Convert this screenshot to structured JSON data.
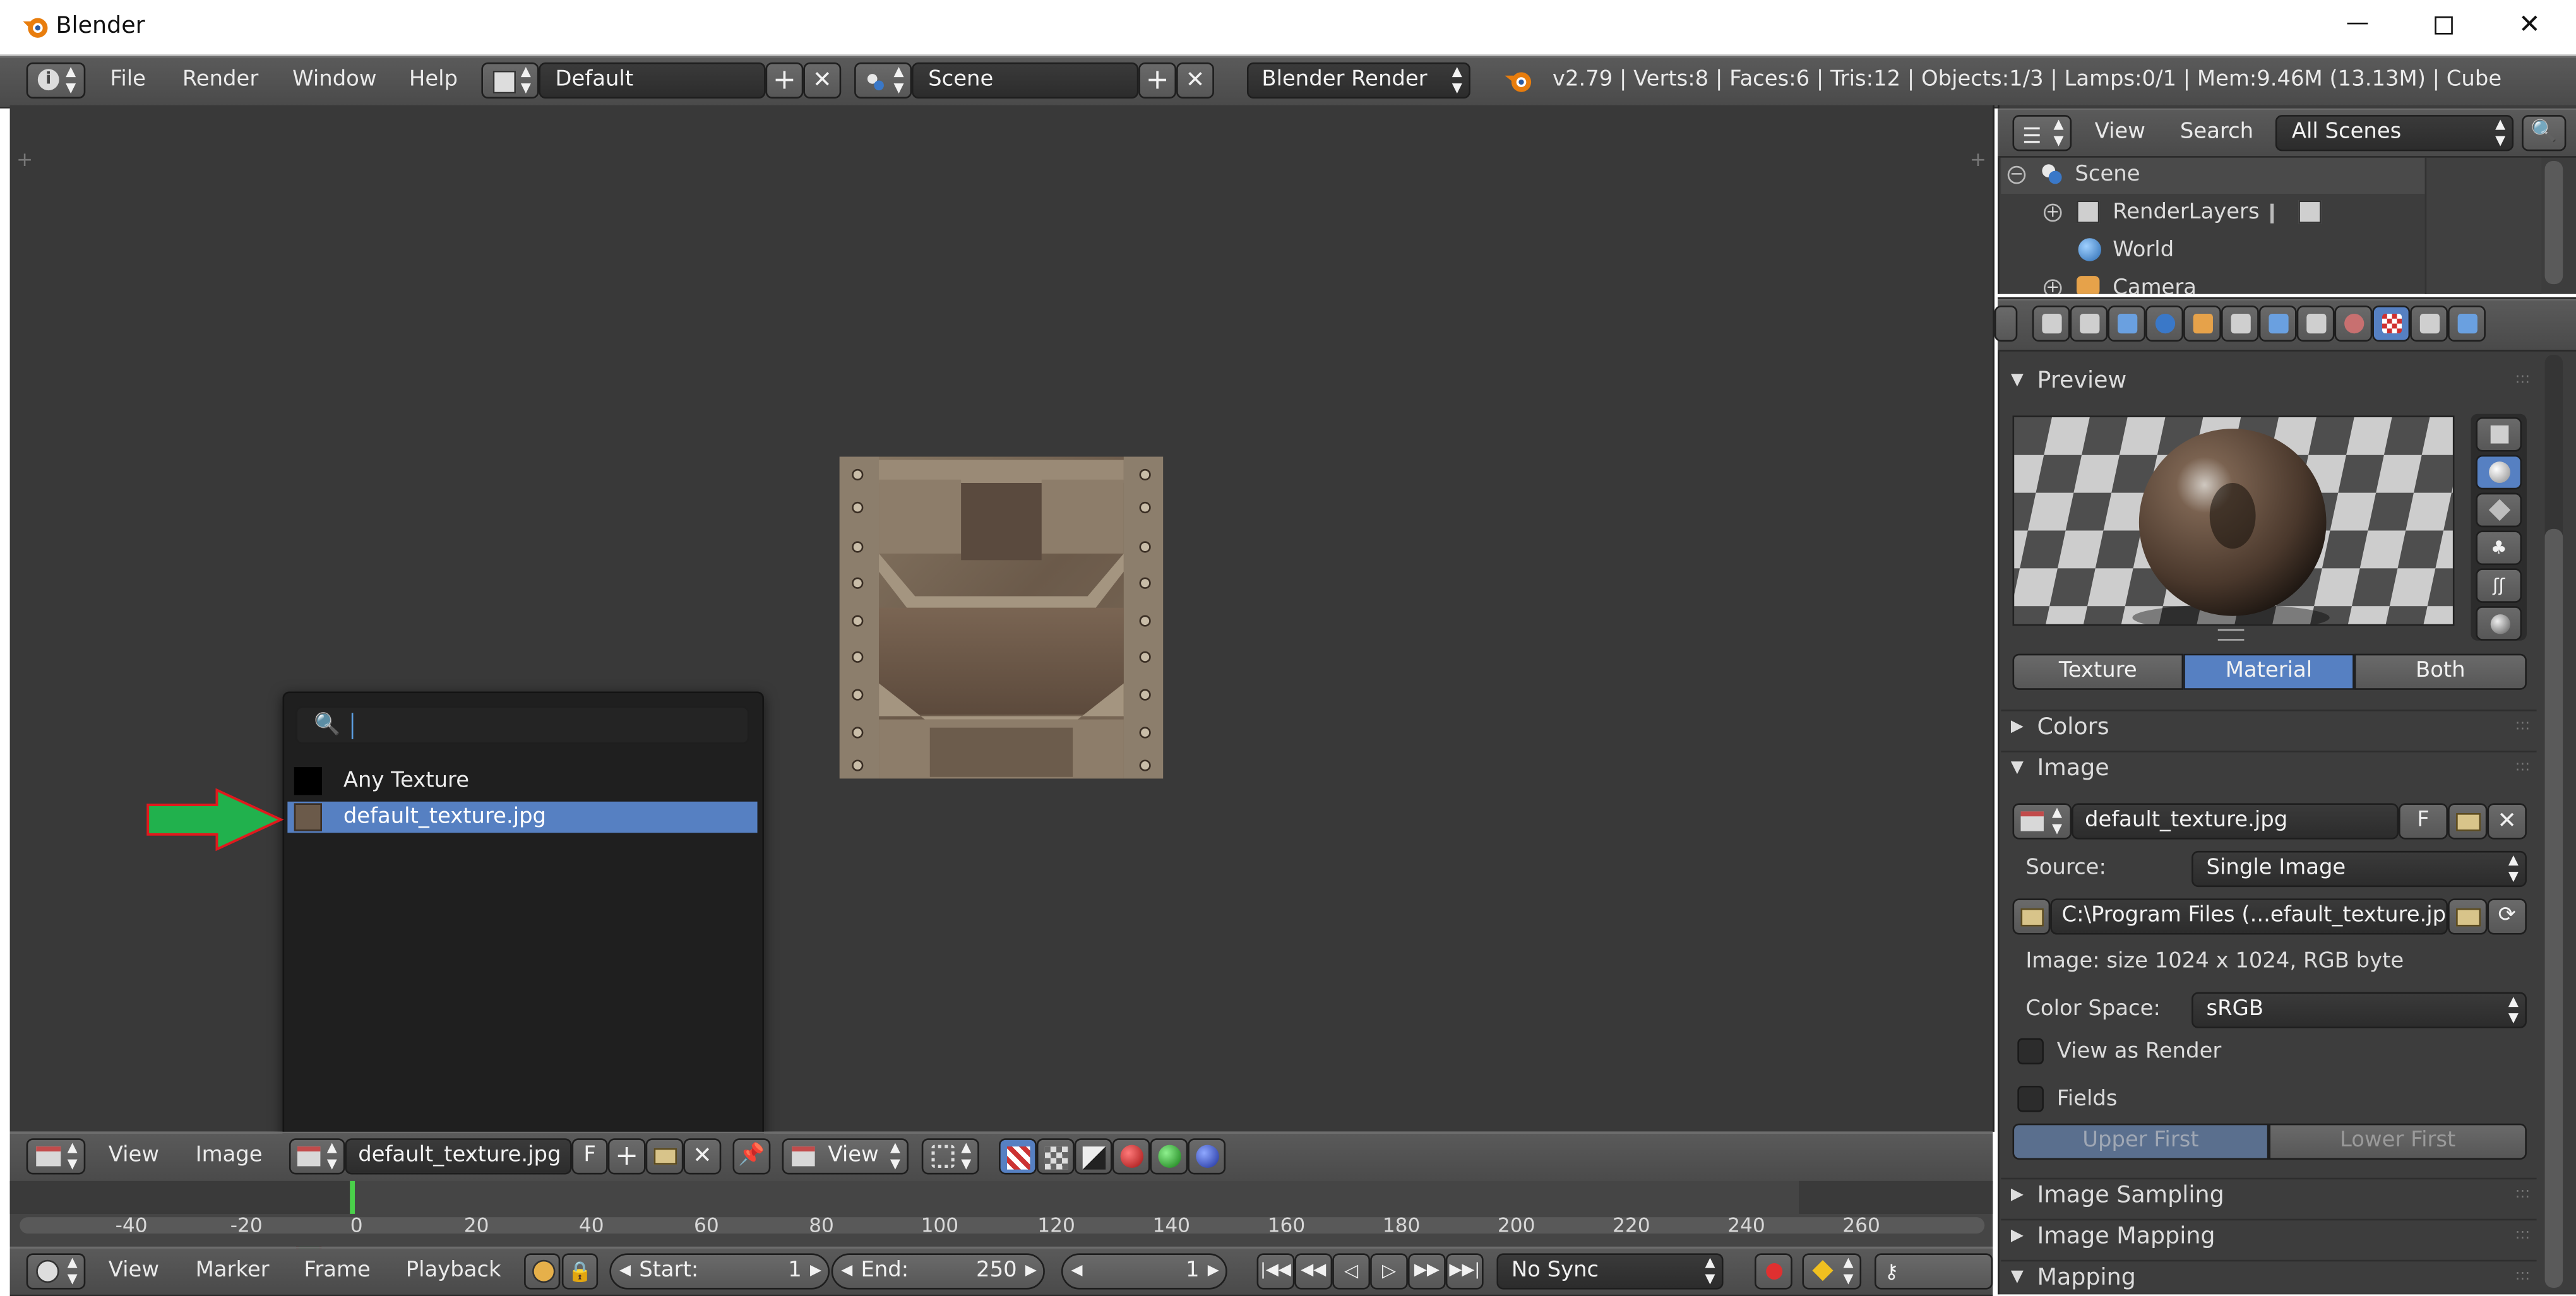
{
  "window": {
    "title": "Blender",
    "minimize_icon": "minimize-icon",
    "maximize_icon": "maximize-icon",
    "close_icon": "close-icon"
  },
  "info_header": {
    "menus": [
      "File",
      "Render",
      "Window",
      "Help"
    ],
    "layout_name": "Default",
    "scene_name": "Scene",
    "engine": "Blender Render",
    "stats": "v2.79 | Verts:8 | Faces:6 | Tris:12 | Objects:1/3 | Lamps:0/1 | Mem:9.46M (13.13M) | Cube"
  },
  "browse_popup": {
    "search_value": "",
    "items": [
      {
        "label": "Any Texture",
        "selected": false
      },
      {
        "label": "default_texture.jpg",
        "selected": true
      }
    ]
  },
  "image_editor_header": {
    "menus": [
      "View",
      "Image"
    ],
    "image_name": "default_texture.jpg",
    "fake_user": "F",
    "view_mode": "View"
  },
  "timeline": {
    "ticks": [
      "-40",
      "-20",
      "0",
      "20",
      "40",
      "60",
      "80",
      "100",
      "120",
      "140",
      "160",
      "180",
      "200",
      "220",
      "240",
      "260"
    ],
    "menus": [
      "View",
      "Marker",
      "Frame",
      "Playback"
    ],
    "start_label": "Start:",
    "start_value": "1",
    "end_label": "End:",
    "end_value": "250",
    "current_frame": "1",
    "sync": "No Sync"
  },
  "outliner": {
    "menus": [
      "View",
      "Search"
    ],
    "filter": "All Scenes",
    "items": [
      {
        "label": "Scene",
        "icon": "scene-icon"
      },
      {
        "label": "RenderLayers",
        "icon": "render-layers-icon"
      },
      {
        "label": "World",
        "icon": "world-icon"
      },
      {
        "label": "Camera",
        "icon": "camera-icon"
      }
    ]
  },
  "properties": {
    "preview_title": "Preview",
    "preview_tabs": [
      "Texture",
      "Material",
      "Both"
    ],
    "preview_active_tab": "Material",
    "colors_title": "Colors",
    "image_title": "Image",
    "image_name": "default_texture.jpg",
    "fake_user": "F",
    "source_label": "Source:",
    "source_value": "Single Image",
    "filepath": "C:\\Program Files (...efault_texture.jpg",
    "image_info": "Image: size 1024 x 1024, RGB byte",
    "color_space_label": "Color Space:",
    "color_space_value": "sRGB",
    "view_as_render": "View as Render",
    "view_as_render_checked": false,
    "fields": "Fields",
    "fields_checked": false,
    "field_order": [
      "Upper First",
      "Lower First"
    ],
    "field_order_active": "Upper First",
    "image_sampling_title": "Image Sampling",
    "image_mapping_title": "Image Mapping",
    "mapping_title": "Mapping"
  },
  "colors": {
    "accent_blue": "#5680c2",
    "annotation_green": "#21b14d",
    "annotation_red_outline": "#e0191d",
    "viewport_bg": "#393939"
  }
}
